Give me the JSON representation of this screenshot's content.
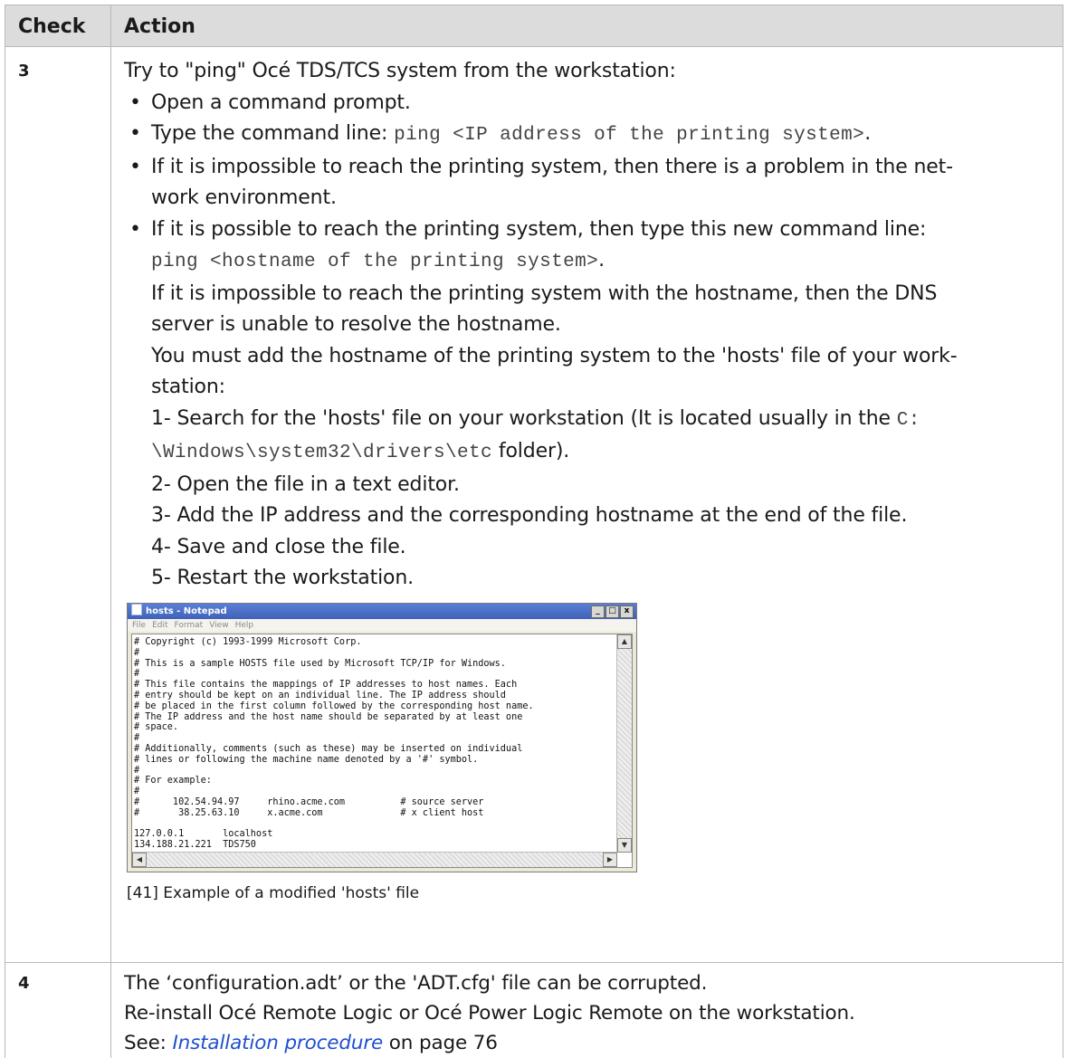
{
  "table": {
    "headers": {
      "check": "Check",
      "action": "Action"
    },
    "row3": {
      "check": "3",
      "intro": "Try to \"ping\" Océ TDS/TCS system from the workstation:",
      "bullets": {
        "b1": "Open a command prompt.",
        "b2_text": "Type the command line: ",
        "b2_code": "ping <IP address of the printing system>",
        "b2_end": ".",
        "b3_line1": "If it is impossible to reach the printing system, then there is a problem in the net-",
        "b3_line2": "work environment.",
        "b4_line1": "If it is possible to reach the printing system, then type this new command line:",
        "b4_code": "ping <hostname of the printing system>",
        "b4_code_end": ".",
        "b4_line3": "If it is impossible to reach the printing system with the hostname, then the DNS",
        "b4_line4": "server is unable to resolve the hostname.",
        "b4_line5": "You must add the hostname of the printing system to the 'hosts' file of your work-",
        "b4_line6": "station:",
        "step1_text": "1- Search for the 'hosts' file on your workstation (It is located usually in the ",
        "step1_code1": "C:",
        "step1_code2": "\\Windows\\system32\\drivers\\etc",
        "step1_end": " folder).",
        "step2": "2- Open the file in a text editor.",
        "step3": "3- Add the IP address and the corresponding hostname at the end of the file.",
        "step4": "4- Save and close the file.",
        "step5": "5- Restart the workstation."
      },
      "bullet_symbol": "•",
      "notepad": {
        "title": "hosts - Notepad",
        "menu": [
          "File",
          "Edit",
          "Format",
          "View",
          "Help"
        ],
        "min": "_",
        "max": "□",
        "close": "x",
        "content": "# Copyright (c) 1993-1999 Microsoft Corp.\n#\n# This is a sample HOSTS file used by Microsoft TCP/IP for Windows.\n#\n# This file contains the mappings of IP addresses to host names. Each\n# entry should be kept on an individual line. The IP address should\n# be placed in the first column followed by the corresponding host name.\n# The IP address and the host name should be separated by at least one\n# space.\n#\n# Additionally, comments (such as these) may be inserted on individual\n# lines or following the machine name denoted by a '#' symbol.\n#\n# For example:\n#\n#      102.54.94.97     rhino.acme.com          # source server\n#       38.25.63.10     x.acme.com              # x client host\n\n127.0.0.1       localhost\n134.188.21.221  TDS750"
      },
      "caption": "[41] Example of a modified 'hosts' file"
    },
    "row4": {
      "check": "4",
      "line1": "The ‘configuration.adt’ or the 'ADT.cfg' file can be corrupted.",
      "line2": "Re-install Océ Remote Logic or Océ Power Logic Remote on the workstation.",
      "see": "See: ",
      "link": "Installation procedure",
      "page_ref": " on page 76"
    }
  }
}
